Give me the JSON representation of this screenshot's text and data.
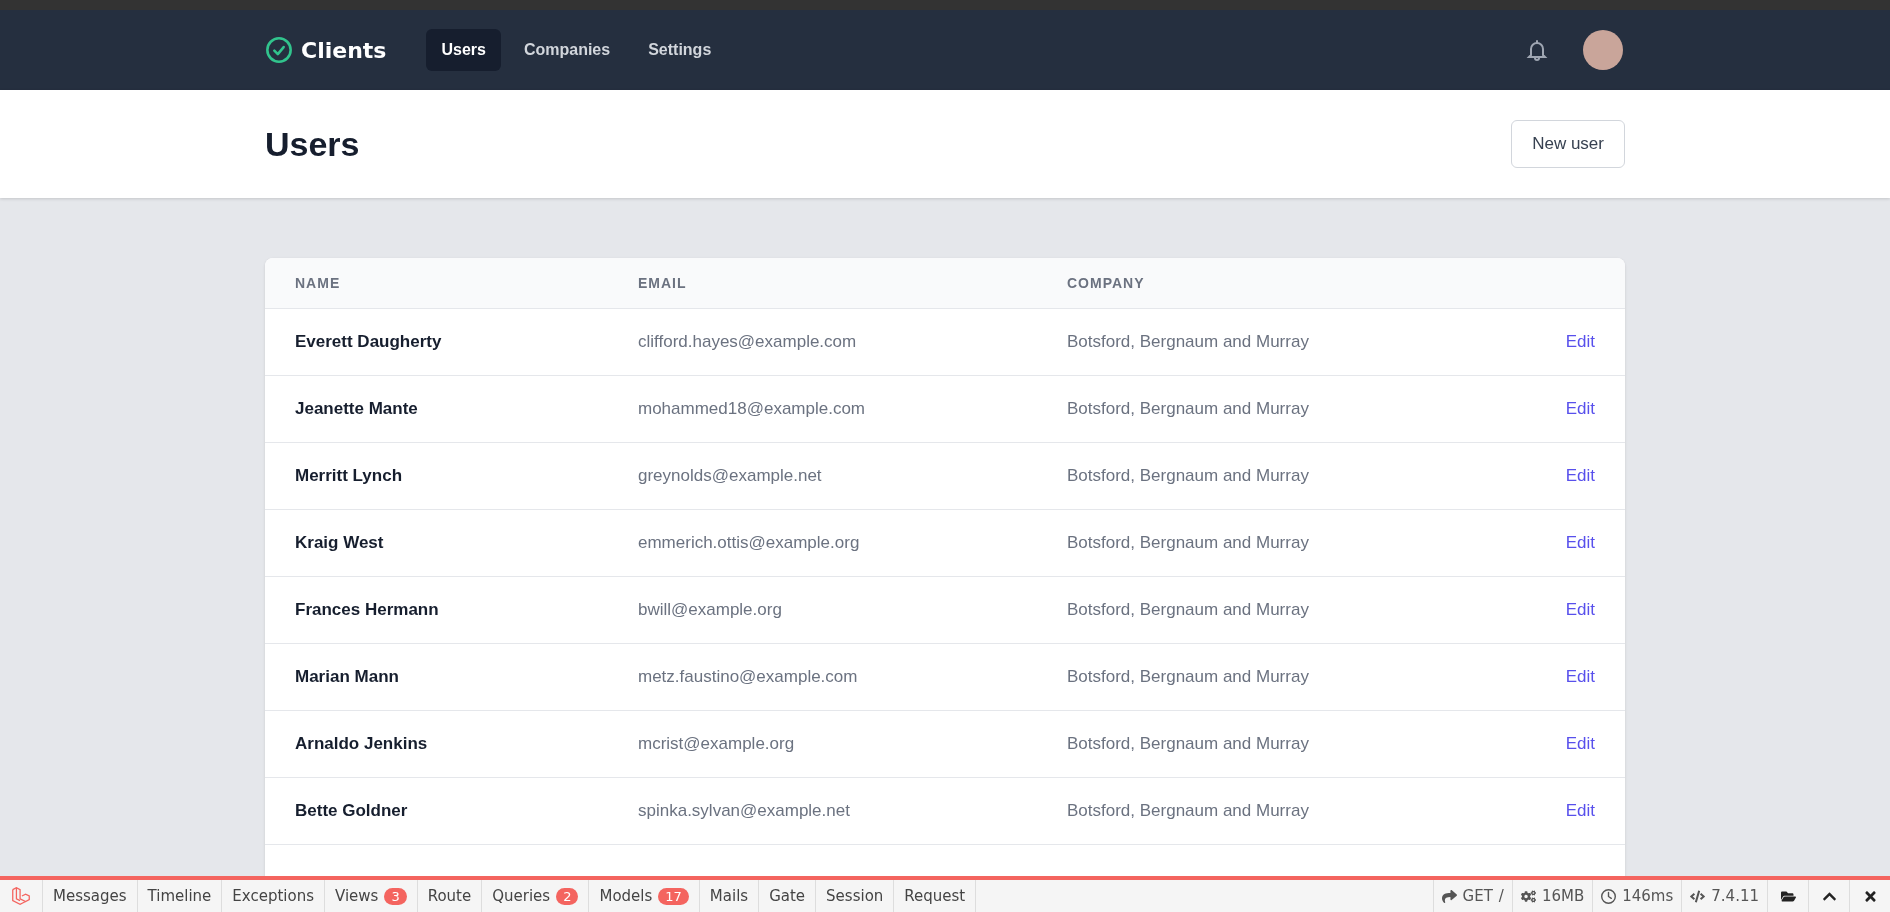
{
  "nav": {
    "brand": "Clients",
    "links": [
      {
        "label": "Users",
        "selected": true
      },
      {
        "label": "Companies",
        "selected": false
      },
      {
        "label": "Settings",
        "selected": false
      }
    ]
  },
  "header": {
    "title": "Users",
    "button": "New user"
  },
  "table": {
    "columns": [
      "NAME",
      "EMAIL",
      "COMPANY"
    ],
    "rows": [
      {
        "name": "Everett Daugherty",
        "email": "clifford.hayes@example.com",
        "company": "Botsford, Bergnaum and Murray",
        "action": "Edit"
      },
      {
        "name": "Jeanette Mante",
        "email": "mohammed18@example.com",
        "company": "Botsford, Bergnaum and Murray",
        "action": "Edit"
      },
      {
        "name": "Merritt Lynch",
        "email": "greynolds@example.net",
        "company": "Botsford, Bergnaum and Murray",
        "action": "Edit"
      },
      {
        "name": "Kraig West",
        "email": "emmerich.ottis@example.org",
        "company": "Botsford, Bergnaum and Murray",
        "action": "Edit"
      },
      {
        "name": "Frances Hermann",
        "email": "bwill@example.org",
        "company": "Botsford, Bergnaum and Murray",
        "action": "Edit"
      },
      {
        "name": "Marian Mann",
        "email": "metz.faustino@example.com",
        "company": "Botsford, Bergnaum and Murray",
        "action": "Edit"
      },
      {
        "name": "Arnaldo Jenkins",
        "email": "mcrist@example.org",
        "company": "Botsford, Bergnaum and Murray",
        "action": "Edit"
      },
      {
        "name": "Bette Goldner",
        "email": "spinka.sylvan@example.net",
        "company": "Botsford, Bergnaum and Murray",
        "action": "Edit"
      }
    ]
  },
  "debugbar": {
    "tabs": [
      {
        "label": "Messages"
      },
      {
        "label": "Timeline"
      },
      {
        "label": "Exceptions"
      },
      {
        "label": "Views",
        "count": "3"
      },
      {
        "label": "Route"
      },
      {
        "label": "Queries",
        "count": "2"
      },
      {
        "label": "Models",
        "count": "17"
      },
      {
        "label": "Mails"
      },
      {
        "label": "Gate"
      },
      {
        "label": "Session"
      },
      {
        "label": "Request"
      }
    ],
    "method": "GET",
    "path": "/",
    "memory": "16MB",
    "time": "146ms",
    "version": "7.4.11"
  }
}
